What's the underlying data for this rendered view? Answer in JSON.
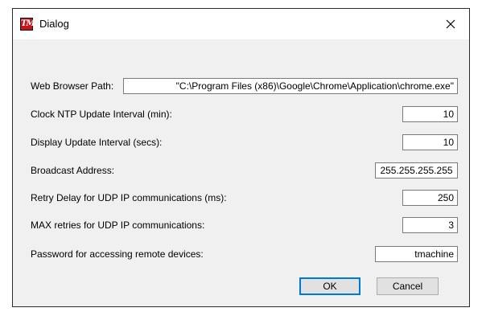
{
  "window": {
    "title": "Dialog",
    "app_icon_text": "TM",
    "app_icon": "tm-app-icon",
    "close_icon": "close-icon"
  },
  "fields": [
    {
      "label": "Web Browser Path:",
      "value": "\"C:\\Program Files (x86)\\Google\\Chrome\\Application\\chrome.exe\""
    },
    {
      "label": "Clock NTP Update Interval (min):",
      "value": "10"
    },
    {
      "label": "Display Update Interval (secs):",
      "value": "10"
    },
    {
      "label": "Broadcast Address:",
      "value": "255.255.255.255"
    },
    {
      "label": "Retry Delay for UDP IP communications (ms):",
      "value": "250"
    },
    {
      "label": "MAX retries for UDP IP communications:",
      "value": "3"
    },
    {
      "label": "Password for accessing remote devices:",
      "value": "tmachine"
    }
  ],
  "buttons": {
    "ok": "OK",
    "cancel": "Cancel"
  },
  "colors": {
    "dialog_bg": "#f0f0f0",
    "titlebar_bg": "#ffffff",
    "icon_red": "#c4161c",
    "default_button_border": "#0078d7"
  }
}
